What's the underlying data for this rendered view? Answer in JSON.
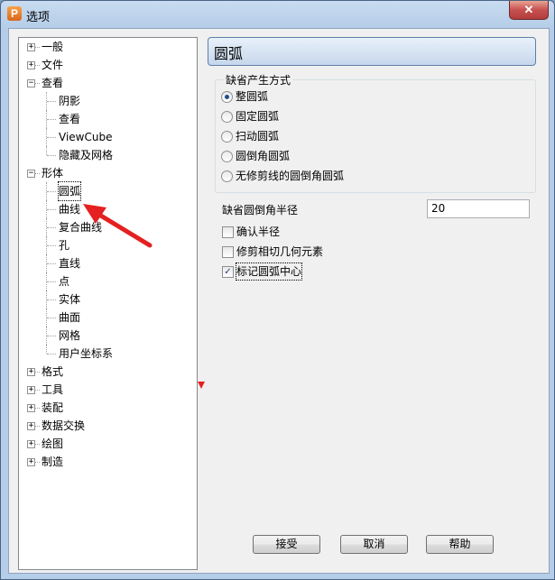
{
  "window": {
    "title": "选项",
    "app_icon": "P",
    "close_label": "✕"
  },
  "tree": {
    "items": [
      {
        "label": "一般",
        "level": 0,
        "expander": "+"
      },
      {
        "label": "文件",
        "level": 0,
        "expander": "+"
      },
      {
        "label": "查看",
        "level": 0,
        "expander": "−"
      },
      {
        "label": "阴影",
        "level": 1
      },
      {
        "label": "查看",
        "level": 1
      },
      {
        "label": "ViewCube",
        "level": 1
      },
      {
        "label": "隐藏及网格",
        "level": 1
      },
      {
        "label": "形体",
        "level": 0,
        "expander": "−"
      },
      {
        "label": "圆弧",
        "level": 1,
        "selected": true
      },
      {
        "label": "曲线",
        "level": 1
      },
      {
        "label": "复合曲线",
        "level": 1
      },
      {
        "label": "孔",
        "level": 1
      },
      {
        "label": "直线",
        "level": 1
      },
      {
        "label": "点",
        "level": 1
      },
      {
        "label": "实体",
        "level": 1
      },
      {
        "label": "曲面",
        "level": 1
      },
      {
        "label": "网格",
        "level": 1
      },
      {
        "label": "用户坐标系",
        "level": 1
      },
      {
        "label": "格式",
        "level": 0,
        "expander": "+"
      },
      {
        "label": "工具",
        "level": 0,
        "expander": "+"
      },
      {
        "label": "装配",
        "level": 0,
        "expander": "+"
      },
      {
        "label": "数据交换",
        "level": 0,
        "expander": "+"
      },
      {
        "label": "绘图",
        "level": 0,
        "expander": "+"
      },
      {
        "label": "制造",
        "level": 0,
        "expander": "+"
      }
    ]
  },
  "panel": {
    "title": "圆弧",
    "group_title": "缺省产生方式",
    "radio_options": [
      {
        "label": "整圆弧",
        "checked": true
      },
      {
        "label": "固定圆弧",
        "checked": false
      },
      {
        "label": "扫动圆弧",
        "checked": false
      },
      {
        "label": "圆倒角圆弧",
        "checked": false
      },
      {
        "label": "无修剪线的圆倒角圆弧",
        "checked": false
      }
    ],
    "radius_label": "缺省圆倒角半径",
    "radius_value": "20",
    "checkboxes": [
      {
        "label": "确认半径",
        "checked": false
      },
      {
        "label": "修剪相切几何元素",
        "checked": false
      },
      {
        "label": "标记圆弧中心",
        "checked": true
      }
    ]
  },
  "buttons": {
    "accept": "接受",
    "cancel": "取消",
    "help": "帮助"
  },
  "colors": {
    "title_bar": "#b5cde8",
    "accent": "#1e4f8f",
    "annotation_arrow": "#e52020"
  }
}
